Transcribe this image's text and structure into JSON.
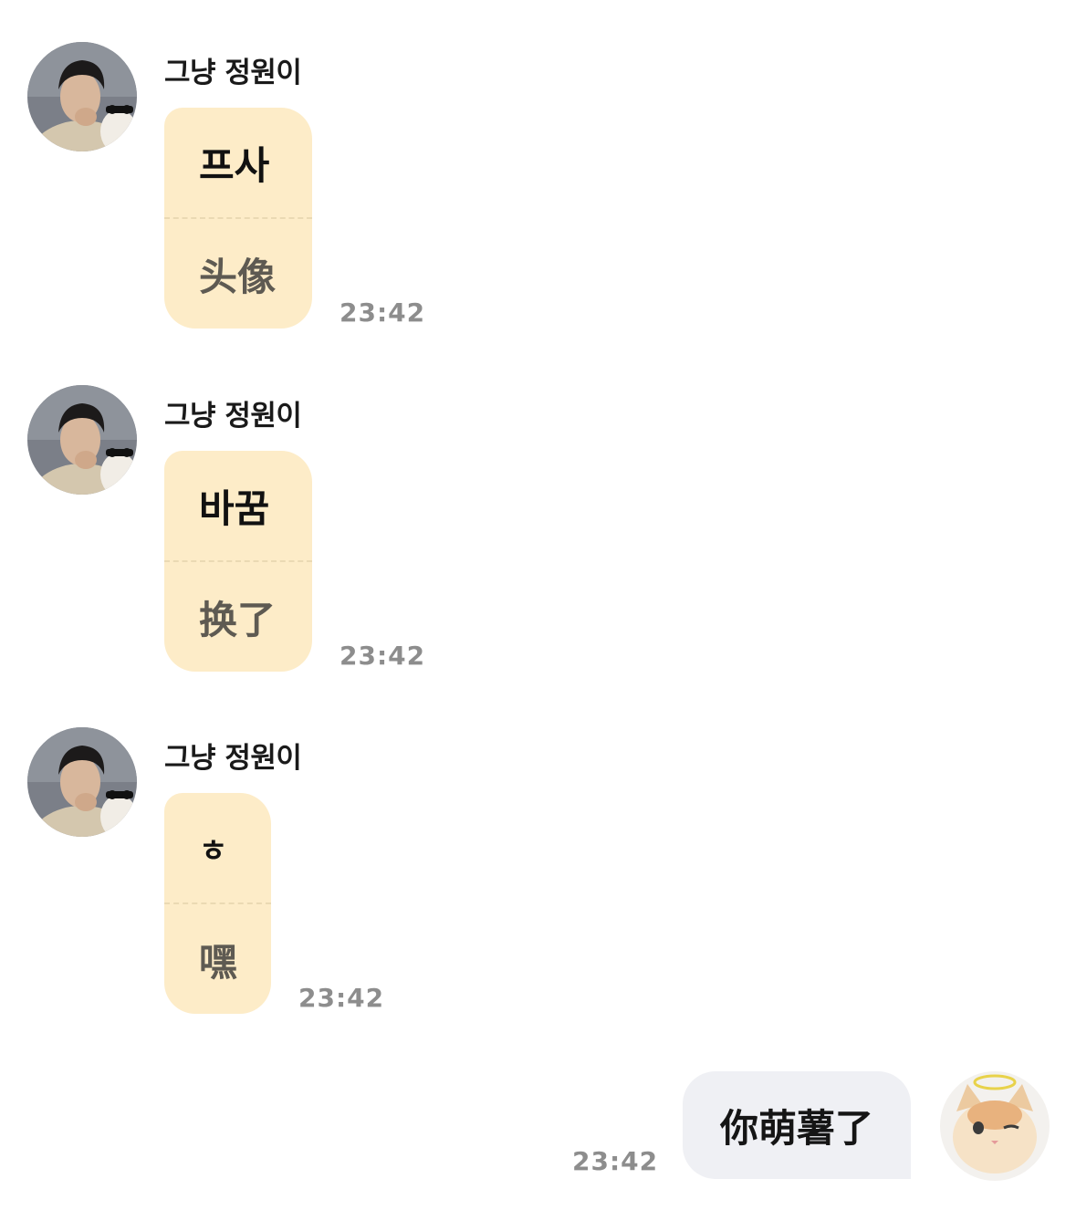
{
  "messages": [
    {
      "sender": "그냥 정원이",
      "original": "프사",
      "translation": "头像",
      "time": "23:42"
    },
    {
      "sender": "그냥 정원이",
      "original": "바꿈",
      "translation": "换了",
      "time": "23:42"
    },
    {
      "sender": "그냥 정원이",
      "original": "ㅎ",
      "translation": "嘿",
      "time": "23:42"
    }
  ],
  "reply": {
    "text": "你萌薯了",
    "time": "23:42"
  },
  "colors": {
    "incoming_bubble": "#fdecc8",
    "outgoing_bubble": "#eff0f4",
    "timestamp": "#8d8d8d"
  },
  "icons": {
    "sender_avatar": "person-with-cat-photo-avatar",
    "user_avatar": "cat-with-halo-avatar"
  }
}
